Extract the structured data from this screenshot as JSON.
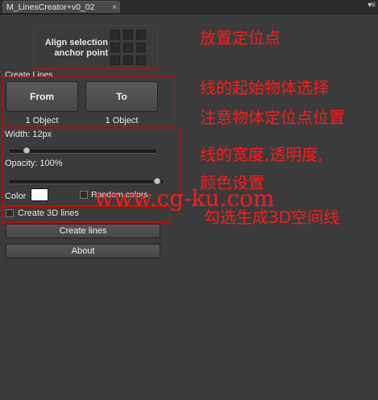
{
  "panel": {
    "tab_title": "M_LinesCreator+v0_02",
    "close_glyph": "×",
    "menu_glyph": "▾≡"
  },
  "align": {
    "label_line1": "Align selection",
    "label_line2": "anchor point",
    "cells": 9
  },
  "create_lines": {
    "section_label": "Create Lines",
    "from_label": "From",
    "to_label": "To",
    "from_status": "1 Object",
    "to_status": "1 Object"
  },
  "width": {
    "label": "Width: 12px",
    "level": 0.12
  },
  "opacity": {
    "label": "Opacity: 100%",
    "level": 1.0
  },
  "color": {
    "label": "Color",
    "swatch": "#ffffff"
  },
  "random_colors": {
    "label": "Random colors",
    "checked": false
  },
  "create_3d": {
    "label": "Create 3D lines",
    "checked": false
  },
  "actions": {
    "create_label": "Create lines",
    "about_label": "About"
  },
  "annotations": {
    "anchor": "放置定位点",
    "select_line1": "线的起始物体选择",
    "select_line2": "注意物体定位点位置",
    "style_line1": "线的宽度,透明度,",
    "style_line2": "颜色设置",
    "threed": "勾选生成3D空间线"
  },
  "watermark": "www.cg-ku.com",
  "colors": {
    "annotation_red": "#ff1a1a",
    "panel_bg": "#3b3b3b"
  }
}
